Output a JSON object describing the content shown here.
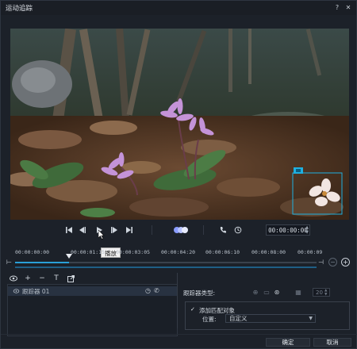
{
  "window": {
    "title": "运动追踪",
    "help_label": "?",
    "close_label": "✕"
  },
  "transport": {
    "timecode": "00:00:00:00",
    "tooltip": "播放"
  },
  "ruler": {
    "ticks": [
      "00:00:00:00",
      "00:00:01:15",
      "00:00:03:05",
      "00:00:04:20",
      "00:00:06:10",
      "00:00:08:00",
      "00:00:09"
    ]
  },
  "scrub": {
    "progress": 0.18
  },
  "tracker_list": {
    "items": [
      {
        "name": "跟踪器 01"
      }
    ]
  },
  "properties": {
    "tracker_type_label": "跟踪器类型:",
    "size_value": "20",
    "add_match_object_label": "添加匹配对象",
    "add_match_object_checked": true,
    "position_label": "位置:",
    "position_value": "自定义"
  },
  "footer": {
    "ok_label": "确定",
    "cancel_label": "取消"
  },
  "colors": {
    "accent": "#2aa0d8",
    "tracker_box": "#1fb0e0",
    "background": "#1c2129"
  }
}
